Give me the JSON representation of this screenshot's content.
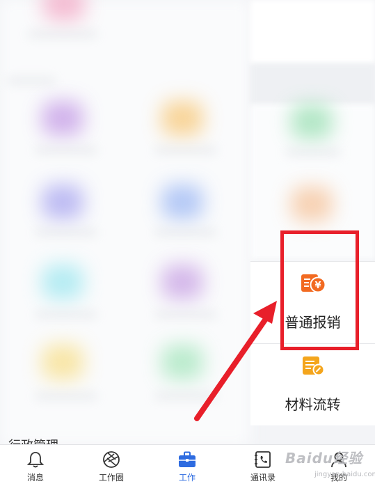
{
  "tiles": {
    "expense": {
      "label": "普通报销",
      "icon": "yuan-coins-icon",
      "color": "#f26a21"
    },
    "materials": {
      "label": "材料流转",
      "icon": "document-edit-icon",
      "color": "#f4a51c"
    }
  },
  "section": {
    "partial_title": "行政管理"
  },
  "tabbar": {
    "items": [
      {
        "label": "消息",
        "icon": "bell-icon"
      },
      {
        "label": "工作圈",
        "icon": "aperture-icon"
      },
      {
        "label": "工作",
        "icon": "briefcase-icon",
        "active": true
      },
      {
        "label": "通讯录",
        "icon": "phone-book-icon"
      },
      {
        "label": "我的",
        "icon": "user-icon"
      }
    ]
  },
  "annotation": {
    "highlight_color": "#e81f2a"
  },
  "watermark": {
    "brand": "Baidu经验",
    "url": "jingyan.baidu.com"
  },
  "colors": {
    "accent": "#2d6be0",
    "annotation": "#e81f2a"
  }
}
